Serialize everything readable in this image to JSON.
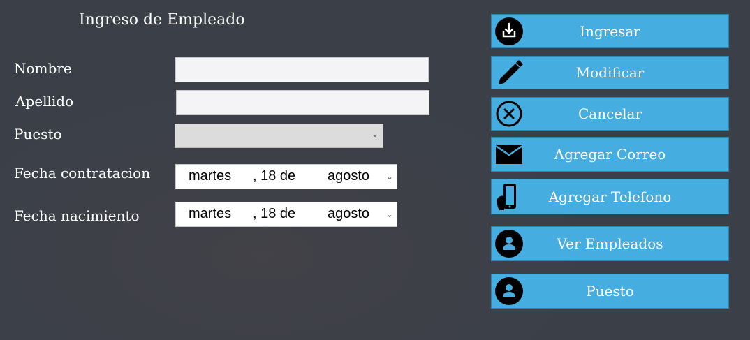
{
  "form": {
    "title": "Ingreso de Empleado",
    "nombre_label": "Nombre",
    "nombre_value": "",
    "apellido_label": "Apellido",
    "apellido_value": "",
    "puesto_label": "Puesto",
    "puesto_value": "",
    "fecha_contratacion_label": "Fecha contratacion",
    "fecha_nacimiento_label": "Fecha nacimiento",
    "fecha_contratacion": {
      "weekday": "martes",
      "day": ", 18 de",
      "month": "agosto"
    },
    "fecha_nacimiento": {
      "weekday": "martes",
      "day": ", 18 de",
      "month": "agosto"
    }
  },
  "buttons": [
    {
      "label": "Ingresar",
      "icon": "download-tray-icon"
    },
    {
      "label": "Modificar",
      "icon": "pencil-icon"
    },
    {
      "label": "Cancelar",
      "icon": "cancel-circle-icon"
    },
    {
      "label": "Agregar Correo",
      "icon": "envelope-icon"
    },
    {
      "label": "Agregar Telefono",
      "icon": "phone-hand-icon"
    },
    {
      "label": "Ver Empleados",
      "icon": "user-icon"
    },
    {
      "label": "Puesto",
      "icon": "user-icon"
    }
  ],
  "colors": {
    "background": "#3a3f48",
    "button": "#45ade0",
    "button_border": "#2f86b2"
  }
}
